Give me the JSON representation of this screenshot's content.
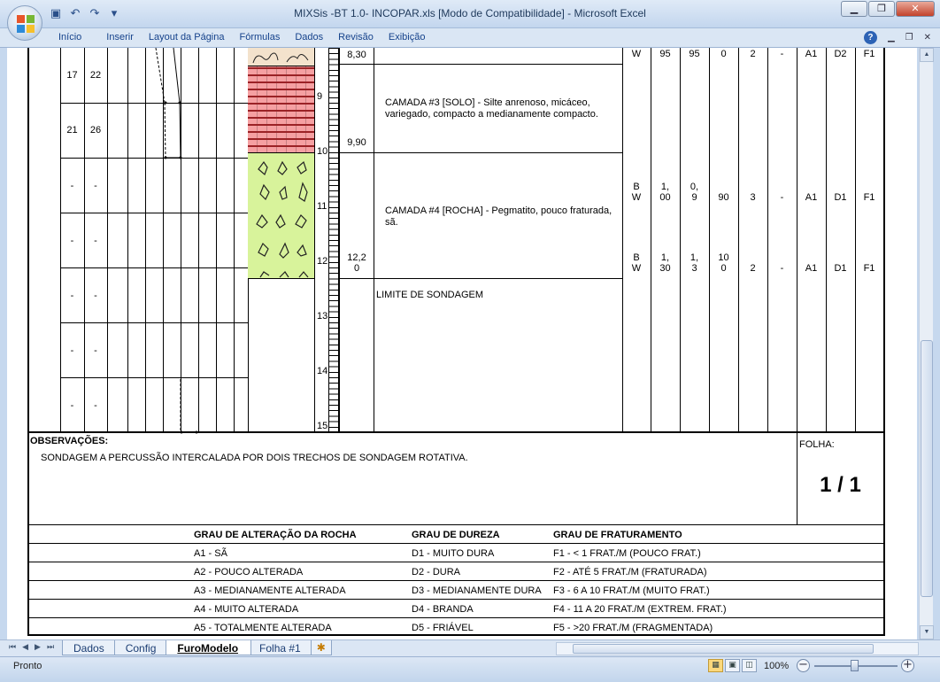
{
  "window": {
    "title": "MIXSis -BT 1.0- INCOPAR.xls  [Modo de Compatibilidade] - Microsoft Excel",
    "controls": {
      "minimize": "▁",
      "restore": "❐",
      "close": "✕"
    }
  },
  "qat": {
    "icons": [
      "save-icon",
      "undo-icon",
      "redo-icon",
      "customize-icon"
    ],
    "save": "▣",
    "undo": "↶",
    "redo": "↷",
    "more": "▾"
  },
  "ribbon": {
    "tabs": [
      "Início",
      "Inserir",
      "Layout da Página",
      "Fórmulas",
      "Dados",
      "Revisão",
      "Exibição"
    ],
    "help": "?",
    "doc_minimize": "▁",
    "doc_restore": "❐",
    "doc_close": "✕"
  },
  "log": {
    "spt_rows": [
      {
        "a": "17",
        "b": "22"
      },
      {
        "a": "21",
        "b": "26"
      },
      {
        "a": "-",
        "b": "-"
      },
      {
        "a": "-",
        "b": "-"
      },
      {
        "a": "-",
        "b": "-"
      },
      {
        "a": "-",
        "b": "-"
      },
      {
        "a": "-",
        "b": "-"
      }
    ],
    "depth_marks": [
      "9",
      "10",
      "11",
      "12",
      "13",
      "14",
      "15"
    ],
    "layer_depths": [
      "8,30",
      "9,90",
      "12,2\n0"
    ],
    "layers": [
      "CAMADA #3 [SOLO] - Silte anrenoso, micáceo, variegado, compacto a medianamente compacto.",
      "CAMADA #4 [ROCHA] - Pegmatito, pouco fraturada, sã.",
      "LIMITE DE SONDAGEM"
    ],
    "rock_rows": [
      {
        "diam": "W",
        "rec": "95",
        "rqd": "95",
        "perda": "0",
        "frat": "2",
        "x": "-",
        "alt": "A1",
        "dur": "D2",
        "fr": "F1"
      },
      {
        "diam": "B\nW",
        "rec": "1,\n00",
        "rqd": "0,\n9",
        "perda": "90",
        "frat": "3",
        "x": "-",
        "alt": "A1",
        "dur": "D1",
        "fr": "F1"
      },
      {
        "diam": "B\nW",
        "rec": "1,\n30",
        "rqd": "1,\n3",
        "perda": "10\n0",
        "frat": "2",
        "x": "-",
        "alt": "A1",
        "dur": "D1",
        "fr": "F1"
      }
    ]
  },
  "observacoes": {
    "label": "OBSERVAÇÕES:",
    "text": "SONDAGEM A PERCUSSÃO INTERCALADA POR DOIS TRECHOS DE SONDAGEM ROTATIVA.",
    "folha_label": "FOLHA:",
    "folha_value": "1 / 1"
  },
  "legend": {
    "headers": [
      "GRAU DE ALTERAÇÃO DA ROCHA",
      "GRAU DE DUREZA",
      "GRAU DE FRATURAMENTO"
    ],
    "rows": [
      [
        "A1 - SÃ",
        "D1 - MUITO DURA",
        "F1 - < 1 FRAT./M (POUCO FRAT.)"
      ],
      [
        "A2 - POUCO ALTERADA",
        "D2 - DURA",
        "F2 - ATÉ 5 FRAT./M (FRATURADA)"
      ],
      [
        "A3 - MEDIANAMENTE ALTERADA",
        "D3 - MEDIANAMENTE DURA",
        "F3 - 6 A 10 FRAT./M (MUITO FRAT.)"
      ],
      [
        "A4 - MUITO ALTERADA",
        "D4 - BRANDA",
        "F4 - 11 A 20 FRAT./M (EXTREM. FRAT.)"
      ],
      [
        "A5 - TOTALMENTE ALTERADA",
        "D5 - FRIÁVEL",
        "F5 - >20 FRAT./M (FRAGMENTADA)"
      ]
    ]
  },
  "sheet_tabs": {
    "nav": [
      "⏮",
      "◀",
      "▶",
      "⏭"
    ],
    "tabs": [
      "Dados",
      "Config",
      "FuroModelo",
      "Folha #1"
    ],
    "active": "FuroModelo",
    "insert": "✱"
  },
  "status": {
    "text": "Pronto",
    "zoom": "100%",
    "view_normal": "▦",
    "view_layout": "▣",
    "view_pagebreak": "◫",
    "zoom_minus": "−",
    "zoom_plus": "+"
  },
  "scroll": {
    "up": "▲",
    "down": "▼",
    "left": "◀",
    "right": "▶"
  },
  "colors": {
    "ribbon_text": "#15428b",
    "soil_hatch": "#f5a0a2",
    "rock_fill": "#d8f39b",
    "title_text": "#1e395b"
  }
}
